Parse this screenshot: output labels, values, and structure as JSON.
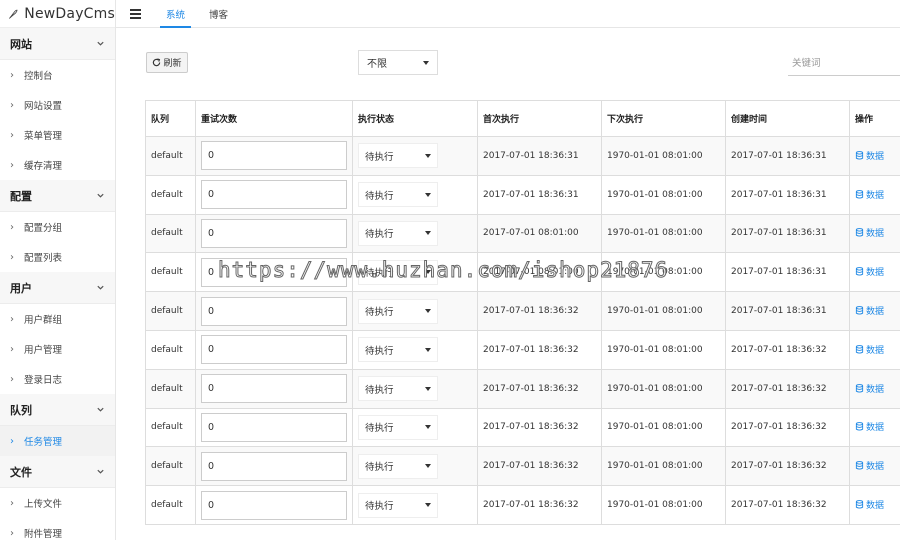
{
  "brand": {
    "name": "NewDayCms"
  },
  "topbar": {
    "tabs": [
      {
        "label": "系统",
        "active": true
      },
      {
        "label": "博客",
        "active": false
      }
    ]
  },
  "sidebar": {
    "groups": [
      {
        "title": "网站",
        "items": [
          {
            "label": "控制台"
          },
          {
            "label": "网站设置"
          },
          {
            "label": "菜单管理"
          },
          {
            "label": "缓存清理"
          }
        ]
      },
      {
        "title": "配置",
        "items": [
          {
            "label": "配置分组"
          },
          {
            "label": "配置列表"
          }
        ]
      },
      {
        "title": "用户",
        "items": [
          {
            "label": "用户群组"
          },
          {
            "label": "用户管理"
          },
          {
            "label": "登录日志"
          }
        ]
      },
      {
        "title": "队列",
        "items": [
          {
            "label": "任务管理",
            "active": true
          }
        ]
      },
      {
        "title": "文件",
        "items": [
          {
            "label": "上传文件"
          },
          {
            "label": "附件管理"
          }
        ]
      }
    ]
  },
  "toolbar": {
    "refresh_label": "刷新",
    "filter_value": "不限",
    "keyword_placeholder": "关键词"
  },
  "table": {
    "headers": [
      "队列",
      "重试次数",
      "执行状态",
      "首次执行",
      "下次执行",
      "创建时间",
      "操作"
    ],
    "action_label": "数据",
    "rows": [
      {
        "queue": "default",
        "retries": "0",
        "status": "待执行",
        "first": "2017-07-01 18:36:31",
        "next": "1970-01-01 08:01:00",
        "created": "2017-07-01 18:36:31"
      },
      {
        "queue": "default",
        "retries": "0",
        "status": "待执行",
        "first": "2017-07-01 18:36:31",
        "next": "1970-01-01 08:01:00",
        "created": "2017-07-01 18:36:31"
      },
      {
        "queue": "default",
        "retries": "0",
        "status": "待执行",
        "first": "2017-07-01 08:01:00",
        "next": "1970-01-01 08:01:00",
        "created": "2017-07-01 18:36:31"
      },
      {
        "queue": "default",
        "retries": "0",
        "status": "待执行",
        "first": "2017-07-01 08:01:00",
        "next": "1970-01-01 08:01:00",
        "created": "2017-07-01 18:36:31"
      },
      {
        "queue": "default",
        "retries": "0",
        "status": "待执行",
        "first": "2017-07-01 18:36:32",
        "next": "1970-01-01 08:01:00",
        "created": "2017-07-01 18:36:31"
      },
      {
        "queue": "default",
        "retries": "0",
        "status": "待执行",
        "first": "2017-07-01 18:36:32",
        "next": "1970-01-01 08:01:00",
        "created": "2017-07-01 18:36:32"
      },
      {
        "queue": "default",
        "retries": "0",
        "status": "待执行",
        "first": "2017-07-01 18:36:32",
        "next": "1970-01-01 08:01:00",
        "created": "2017-07-01 18:36:32"
      },
      {
        "queue": "default",
        "retries": "0",
        "status": "待执行",
        "first": "2017-07-01 18:36:32",
        "next": "1970-01-01 08:01:00",
        "created": "2017-07-01 18:36:32"
      },
      {
        "queue": "default",
        "retries": "0",
        "status": "待执行",
        "first": "2017-07-01 18:36:32",
        "next": "1970-01-01 08:01:00",
        "created": "2017-07-01 18:36:32"
      },
      {
        "queue": "default",
        "retries": "0",
        "status": "待执行",
        "first": "2017-07-01 18:36:32",
        "next": "1970-01-01 08:01:00",
        "created": "2017-07-01 18:36:32"
      }
    ]
  },
  "watermark": {
    "text": "https://www.huzhan.com/ishop21876"
  },
  "colors": {
    "accent": "#1e88e5",
    "border": "#dddddd",
    "row_alt": "#f9f9f9"
  },
  "icons": {
    "brand": "feather-pen-icon",
    "menu": "hamburger-menu-icon",
    "refresh": "refresh-icon",
    "chevron": "chevron-down-icon",
    "data": "database-icon"
  }
}
